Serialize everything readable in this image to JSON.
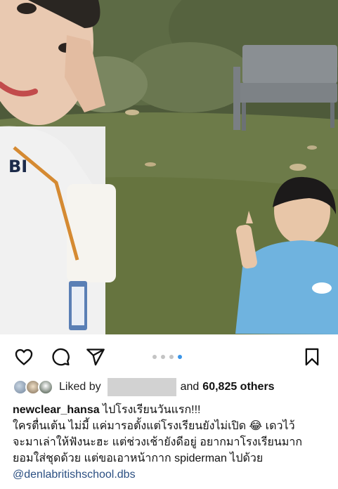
{
  "post": {
    "image_description_icon": "photo",
    "carousel": {
      "count": 4,
      "active_index": 3
    }
  },
  "actions": {
    "like_icon": "heart-outline-icon",
    "comment_icon": "comment-bubble-icon",
    "share_icon": "paper-plane-icon",
    "save_icon": "bookmark-outline-icon"
  },
  "likes": {
    "liked_by_label": "Liked by",
    "and_label": "and",
    "count_text": "60,825 others"
  },
  "caption": {
    "username": "newclear_hansa",
    "title_text": " ไปโรงเรียนวันแรก!!!",
    "line2": "ใครตื่นเต้น ไม่มี้ แค่มารอตั้งแต่โรงเรียนยังไม่เปิด 😂  เดวไว้",
    "line3": "จะมาเล่าให้ฟังนะฮะ แต่ช่วงเช้ายังดีอยู่ อยากมาโรงเรียนมาก",
    "line4": "ยอมใส่ชุดด้วย แต่ขอเอาหน้ากาก spiderman ไปด้วย",
    "mention": "@denlabritishschool.dbs"
  },
  "colors": {
    "accent_blue": "#3a95e8",
    "mention": "#2b4f82",
    "redaction": "#d2d2d2"
  }
}
